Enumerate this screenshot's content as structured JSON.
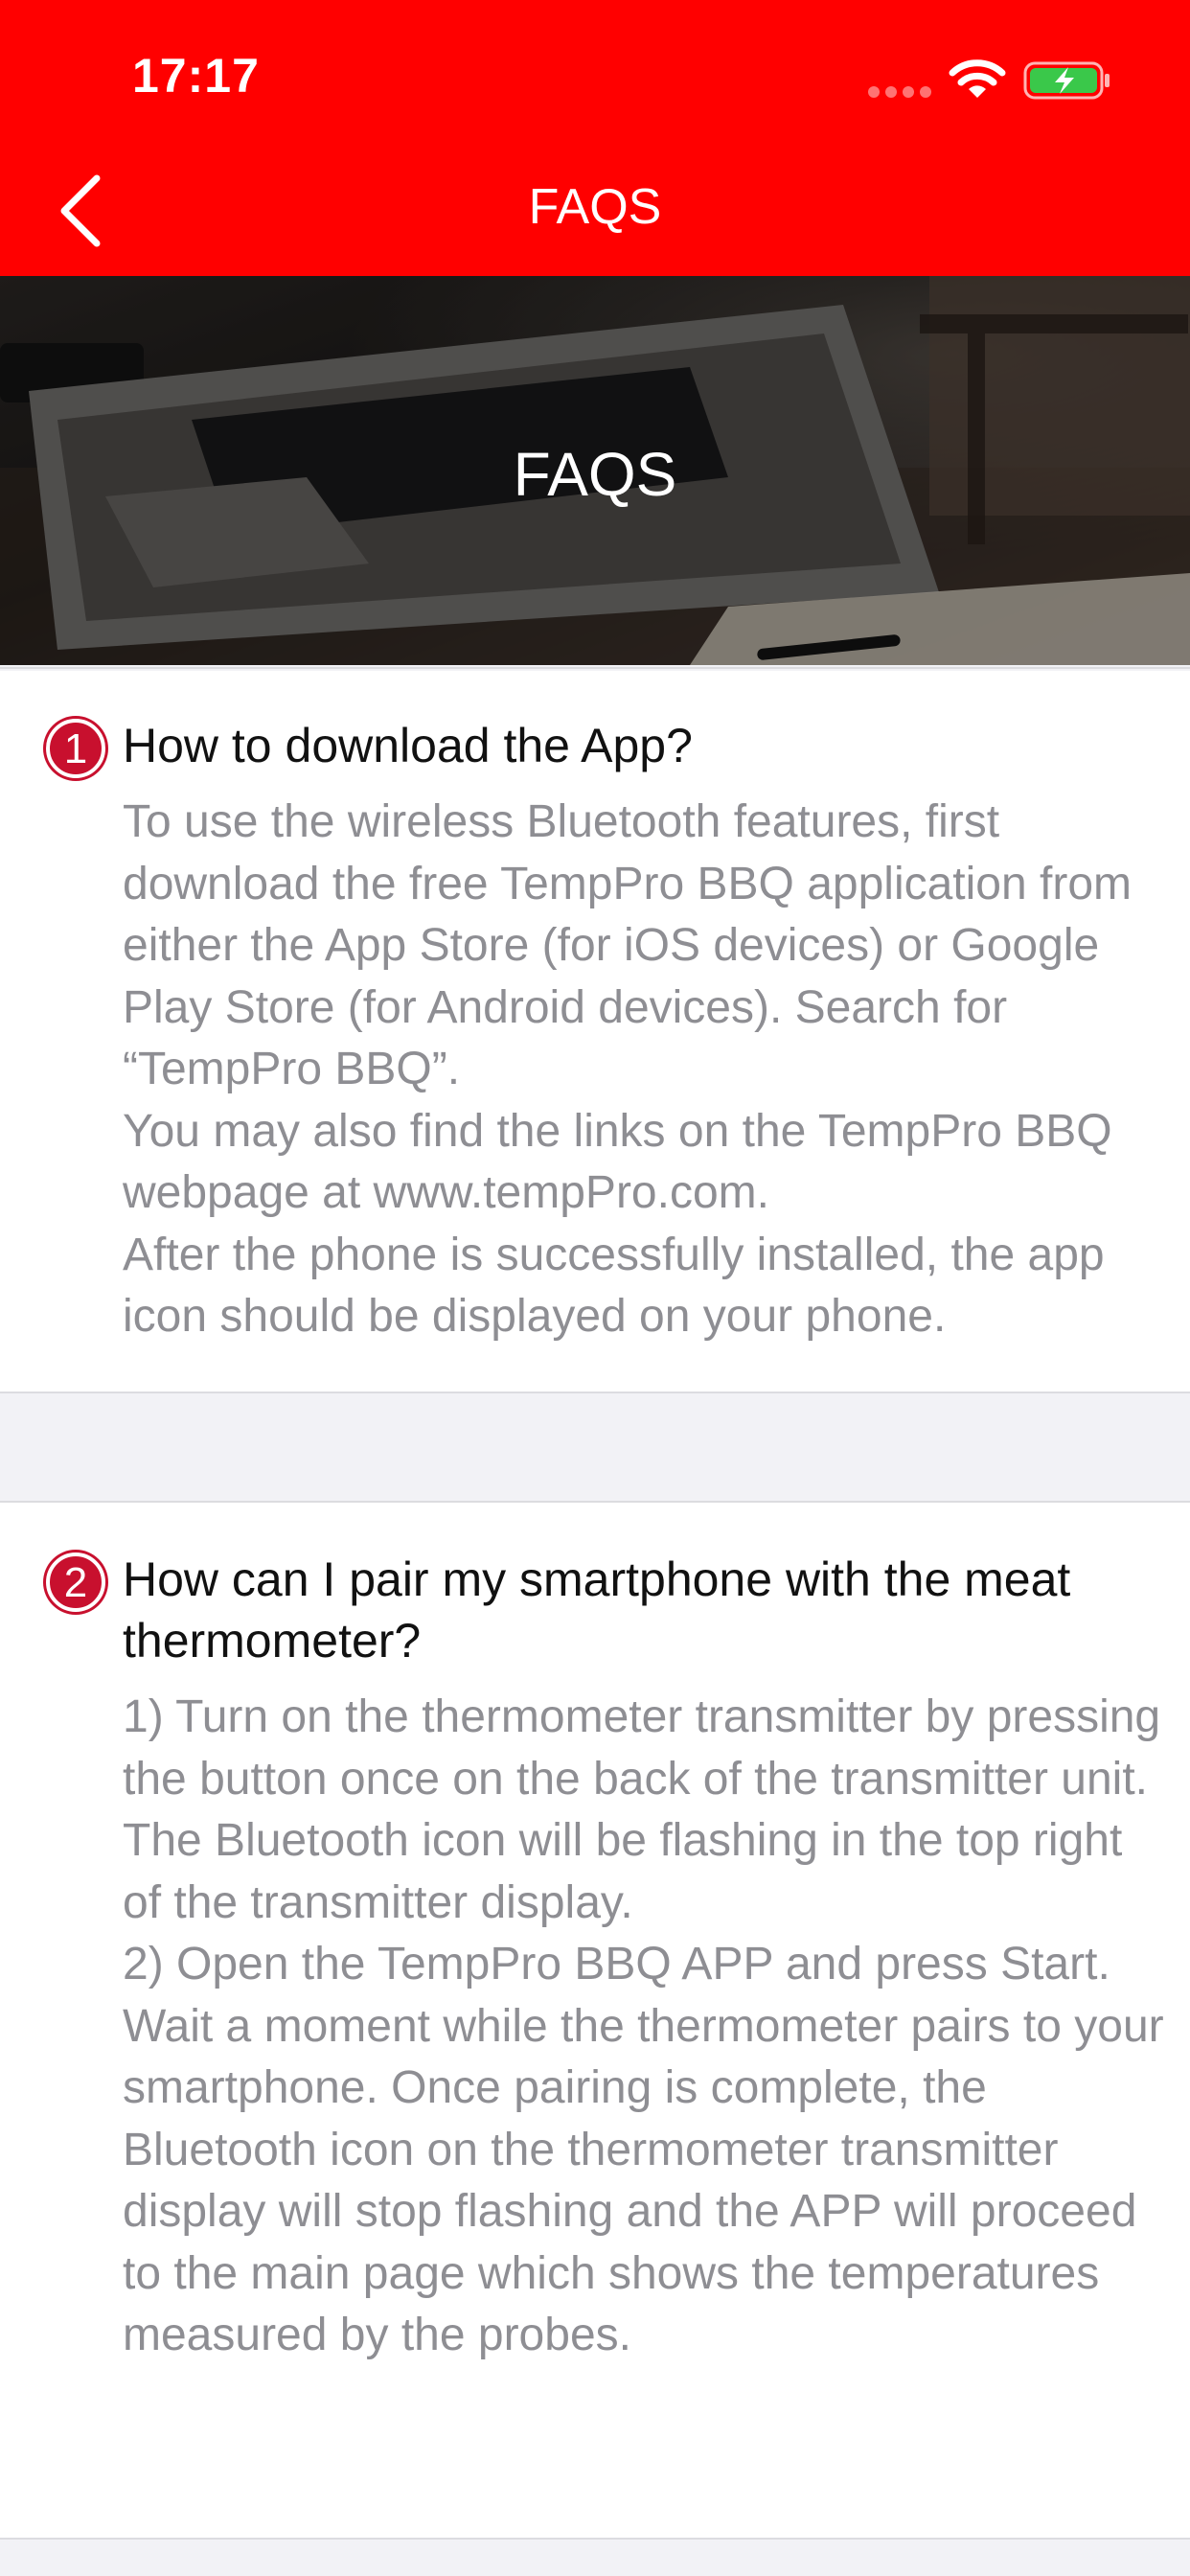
{
  "status_bar": {
    "time": "17:17"
  },
  "nav": {
    "title": "FAQS"
  },
  "hero": {
    "title": "FAQS"
  },
  "faqs": [
    {
      "number": "1",
      "question": "How to download the App?",
      "answer_lines": [
        "To use the wireless Bluetooth features, first download the free TempPro BBQ application from either the App Store (for iOS devices) or Google Play Store (for Android devices). Search for “TempPro BBQ”.",
        "You may also find the links on the TempPro BBQ webpage at www.tempPro.com.",
        "After the phone is successfully installed, the app icon should be displayed on your phone."
      ]
    },
    {
      "number": "2",
      "question": "How can I pair my smartphone with the meat thermometer?",
      "answer_lines": [
        "1) Turn on the thermometer transmitter by pressing the button once on the back of the transmitter unit. The Bluetooth icon will be flashing in the top right of the transmitter display.",
        "2) Open the TempPro BBQ APP and press Start. Wait a moment while the thermometer pairs to your smartphone. Once pairing is complete, the Bluetooth icon on the thermometer transmitter display will stop flashing and the APP will proceed to the main page which shows the temperatures measured by the probes."
      ]
    }
  ],
  "colors": {
    "accent": "#ff0000",
    "badge": "#c8102e",
    "answer_text": "#8e8e93",
    "background": "#f2f2f6"
  },
  "icons": {
    "back": "chevron-left-icon",
    "wifi": "wifi-icon",
    "battery": "battery-charging-icon",
    "signal": "cellular-signal-icon"
  }
}
